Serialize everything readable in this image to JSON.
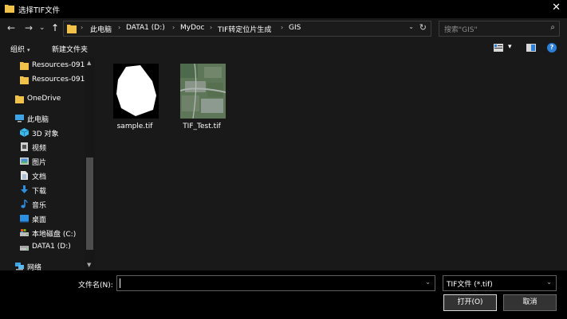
{
  "window": {
    "title": "选择TIF文件",
    "close_icon": "close-icon"
  },
  "nav": {
    "back_icon": "←",
    "forward_icon": "→",
    "dropdown_icon": "⌄",
    "up_icon": "↑",
    "breadcrumbs": [
      "此电脑",
      "DATA1 (D:)",
      "MyDoc",
      "TIF转定位片生成",
      "GIS"
    ],
    "search_placeholder": "搜索\"GIS\""
  },
  "toolbar": {
    "organize": "组织",
    "new_folder": "新建文件夹"
  },
  "sidebar": {
    "items": [
      {
        "label": "Resources-091",
        "icon": "folder-icon"
      },
      {
        "label": "Resources-091",
        "icon": "folder-icon"
      },
      {
        "label": "OneDrive",
        "icon": "folder-icon"
      },
      {
        "label": "此电脑",
        "icon": "computer-icon"
      },
      {
        "label": "3D 对象",
        "icon": "3d-objects-icon"
      },
      {
        "label": "视频",
        "icon": "video-icon"
      },
      {
        "label": "图片",
        "icon": "pictures-icon"
      },
      {
        "label": "文档",
        "icon": "documents-icon"
      },
      {
        "label": "下载",
        "icon": "download-icon"
      },
      {
        "label": "音乐",
        "icon": "music-icon"
      },
      {
        "label": "桌面",
        "icon": "desktop-icon"
      },
      {
        "label": "本地磁盘 (C:)",
        "icon": "drive-icon"
      },
      {
        "label": "DATA1 (D:)",
        "icon": "drive-icon"
      },
      {
        "label": "网络",
        "icon": "network-icon"
      }
    ]
  },
  "files": [
    {
      "name": "sample.tif"
    },
    {
      "name": "TIF_Test.tif"
    }
  ],
  "bottom": {
    "filename_label": "文件名(N):",
    "filename_value": "",
    "filter": "TIF文件 (*.tif)",
    "open_button": "打开(O)",
    "cancel_button": "取消"
  },
  "colors": {
    "accent": "#2a80d8",
    "folder": "#f0c24a",
    "background": "#191919"
  }
}
